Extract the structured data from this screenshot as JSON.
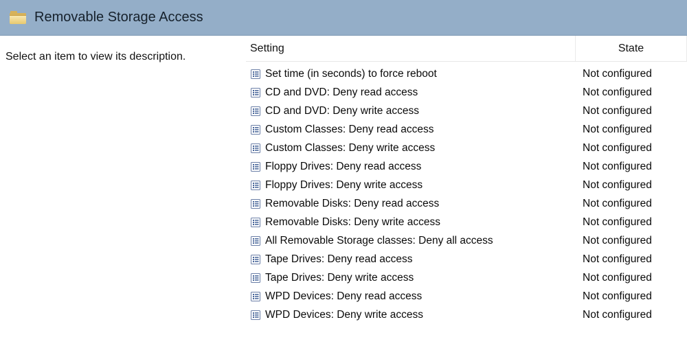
{
  "header": {
    "title": "Removable Storage Access"
  },
  "description": {
    "prompt": "Select an item to view its description."
  },
  "columns": {
    "setting": "Setting",
    "state": "State"
  },
  "settings": [
    {
      "name": "Set time (in seconds) to force reboot",
      "state": "Not configured"
    },
    {
      "name": "CD and DVD: Deny read access",
      "state": "Not configured"
    },
    {
      "name": "CD and DVD: Deny write access",
      "state": "Not configured"
    },
    {
      "name": "Custom Classes: Deny read access",
      "state": "Not configured"
    },
    {
      "name": "Custom Classes: Deny write access",
      "state": "Not configured"
    },
    {
      "name": "Floppy Drives: Deny read access",
      "state": "Not configured"
    },
    {
      "name": "Floppy Drives: Deny write access",
      "state": "Not configured"
    },
    {
      "name": "Removable Disks: Deny read access",
      "state": "Not configured"
    },
    {
      "name": "Removable Disks: Deny write access",
      "state": "Not configured"
    },
    {
      "name": "All Removable Storage classes: Deny all access",
      "state": "Not configured"
    },
    {
      "name": "Tape Drives: Deny read access",
      "state": "Not configured"
    },
    {
      "name": "Tape Drives: Deny write access",
      "state": "Not configured"
    },
    {
      "name": "WPD Devices: Deny read access",
      "state": "Not configured"
    },
    {
      "name": "WPD Devices: Deny write access",
      "state": "Not configured"
    }
  ]
}
